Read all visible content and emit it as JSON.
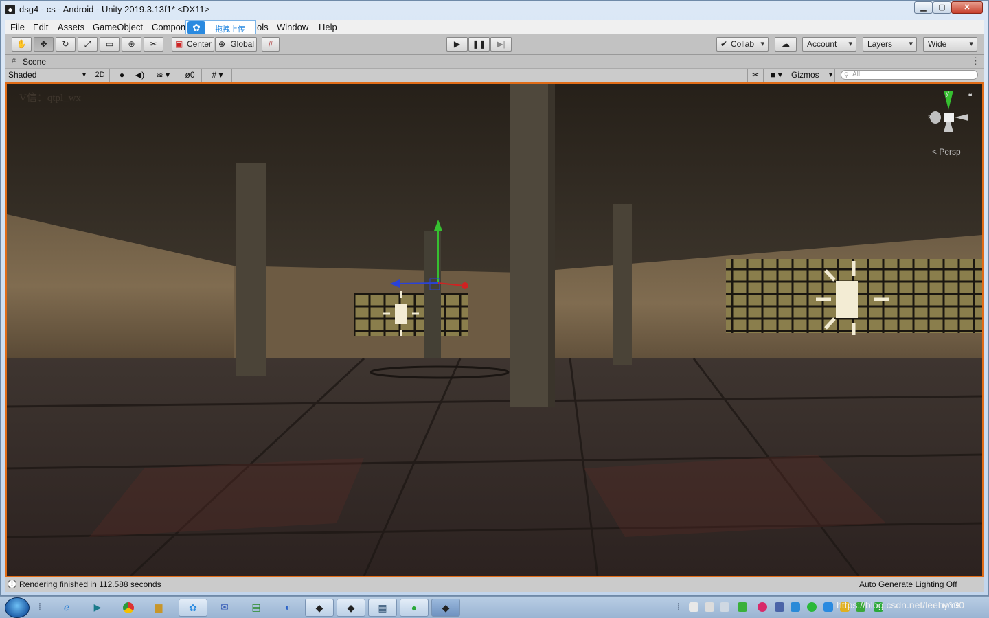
{
  "window": {
    "title": "dsg4 - cs - Android - Unity 2019.3.13f1* <DX11>"
  },
  "menu": [
    "File",
    "Edit",
    "Assets",
    "GameObject",
    "Compon",
    "ols",
    "Window",
    "Help"
  ],
  "overlay_tool": {
    "label": "拖拽上传",
    "icon": "cloud-upload-icon"
  },
  "toolbar": {
    "tools": [
      "hand-tool",
      "move-tool",
      "rotate-tool",
      "scale-tool",
      "rect-tool",
      "transform-tool",
      "custom-tool"
    ],
    "pivot_label": "Center",
    "space_label": "Global",
    "collab_label": "Collab",
    "account_label": "Account",
    "layers_label": "Layers",
    "layout_label": "Wide"
  },
  "scene": {
    "tab_label": "Scene",
    "shading": "Shaded",
    "mode_2d": "2D",
    "hidden_count": "0",
    "gizmos_label": "Gizmos",
    "search_placeholder": "All",
    "watermark": "V信：qtpl_wx",
    "persp_label": "< Persp",
    "gizmo_axes": {
      "y": "y",
      "z": "z"
    }
  },
  "status": {
    "message": "Rendering finished in 112.588 seconds",
    "lighting": "Auto Generate Lighting Off"
  },
  "taskbar": {
    "apps": [
      "ie",
      "media",
      "chrome",
      "explorer",
      "app-a",
      "app-b",
      "app-c",
      "app-d",
      "unity-1",
      "unity-2",
      "calculator",
      "wechat",
      "unity-3"
    ],
    "tray_url": "https://blog.csdn.net/leeby100",
    "clock": "10:05"
  },
  "colors": {
    "accent": "#e06c18",
    "window_bg": "#c2d5ec",
    "toolbar_bg": "#c2c2c2"
  }
}
